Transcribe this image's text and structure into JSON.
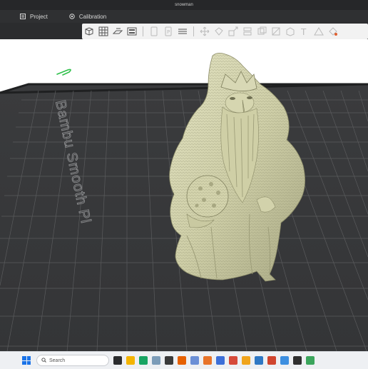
{
  "window": {
    "title": "snowman"
  },
  "tabs": [
    {
      "label": "Project",
      "icon": "project-icon"
    },
    {
      "label": "Calibration",
      "icon": "calibration-icon"
    }
  ],
  "bed": {
    "label": "Bambu Smooth Pl"
  },
  "toolbar": {
    "icons": [
      "add-cube-icon",
      "grid-arrange-icon",
      "plate-icon",
      "layout-icon",
      "orient-icon",
      "auto-plate-icon",
      "layers-icon",
      "move-icon",
      "rotate-icon",
      "scale-icon",
      "cut-icon",
      "support-icon",
      "seam-icon",
      "box-icon",
      "text-icon",
      "measure-icon",
      "paint-icon"
    ]
  },
  "taskbar": {
    "search_placeholder": "Search",
    "apps": [
      "file-explorer-icon",
      "photos-icon",
      "edge-icon",
      "store-icon",
      "terminal-icon",
      "firefox-icon",
      "bambu-icon",
      "mail-icon",
      "calendar-icon",
      "settings-icon",
      "chrome-icon",
      "ms-icon",
      "arc-icon",
      "vlc-icon",
      "browser-icon",
      "bambu-studio-icon"
    ],
    "colors": {
      "accent": "#1a73e8"
    }
  }
}
